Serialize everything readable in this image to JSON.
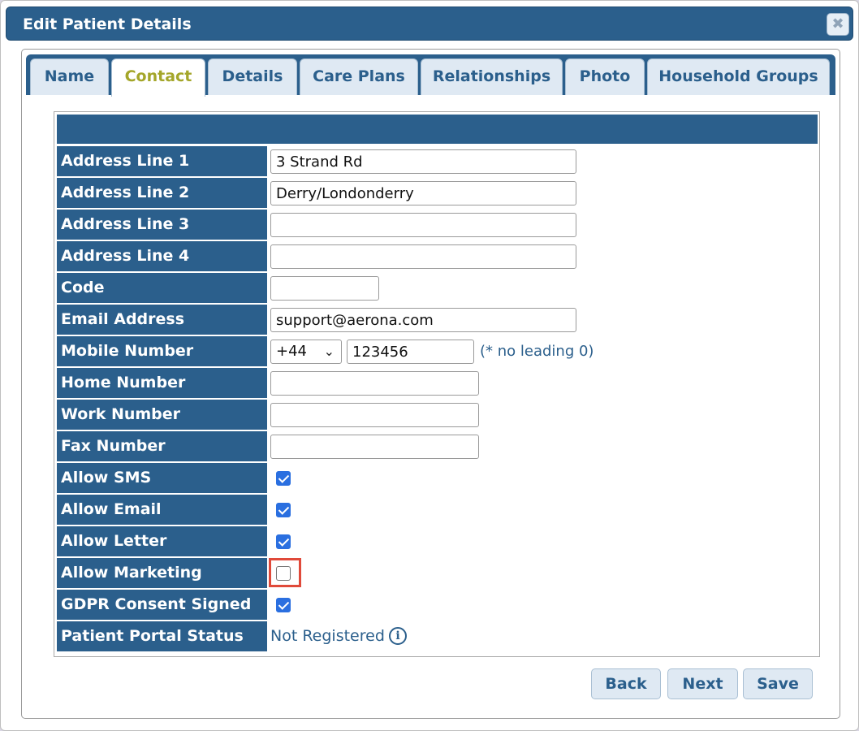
{
  "dialog": {
    "title": "Edit Patient Details",
    "close_icon": "close-icon"
  },
  "tabs": [
    {
      "label": "Name",
      "active": false
    },
    {
      "label": "Contact",
      "active": true
    },
    {
      "label": "Details",
      "active": false
    },
    {
      "label": "Care Plans",
      "active": false
    },
    {
      "label": "Relationships",
      "active": false
    },
    {
      "label": "Photo",
      "active": false
    },
    {
      "label": "Household Groups",
      "active": false
    }
  ],
  "form": {
    "address_line_1": {
      "label": "Address Line 1",
      "value": "3 Strand Rd"
    },
    "address_line_2": {
      "label": "Address Line 2",
      "value": "Derry/Londonderry"
    },
    "address_line_3": {
      "label": "Address Line 3",
      "value": ""
    },
    "address_line_4": {
      "label": "Address Line 4",
      "value": ""
    },
    "code": {
      "label": "Code",
      "value": ""
    },
    "email": {
      "label": "Email Address",
      "value": "support@aerona.com"
    },
    "mobile": {
      "label": "Mobile Number",
      "country_code": "+44",
      "value": "123456",
      "hint": "(* no leading 0)"
    },
    "home": {
      "label": "Home Number",
      "value": ""
    },
    "work": {
      "label": "Work Number",
      "value": ""
    },
    "fax": {
      "label": "Fax Number",
      "value": ""
    },
    "allow_sms": {
      "label": "Allow SMS",
      "checked": true
    },
    "allow_email": {
      "label": "Allow Email",
      "checked": true
    },
    "allow_letter": {
      "label": "Allow Letter",
      "checked": true
    },
    "allow_marketing": {
      "label": "Allow Marketing",
      "checked": false
    },
    "gdpr": {
      "label": "GDPR Consent Signed",
      "checked": true
    },
    "portal": {
      "label": "Patient Portal Status",
      "value": "Not Registered",
      "icon": "info-icon"
    }
  },
  "buttons": {
    "back": "Back",
    "next": "Next",
    "save": "Save"
  },
  "colors": {
    "primary": "#2b5f8c",
    "active_tab_text": "#a4a62a",
    "checkbox_checked": "#2a6fe0",
    "highlight": "#e04a3a"
  }
}
